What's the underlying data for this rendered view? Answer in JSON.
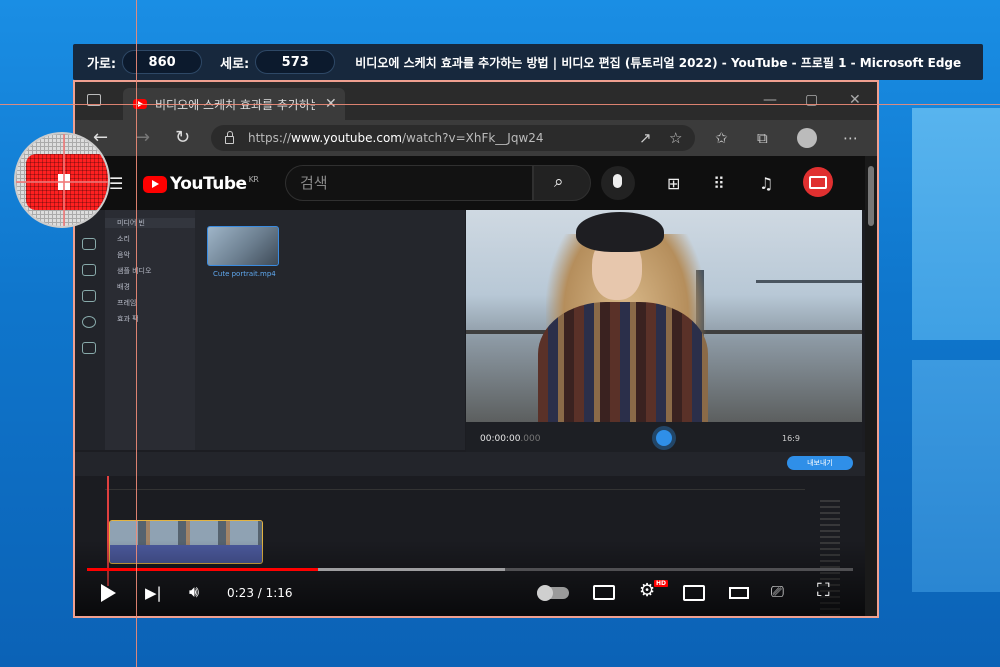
{
  "capture": {
    "width_label": "가로:",
    "width_value": "860",
    "height_label": "세로:",
    "height_value": "573",
    "window_title": "비디오에 스케치 효과를 추가하는 방법 | 비디오 편집 (튜토리얼 2022) - YouTube - 프로필 1 - Microsoft Edge"
  },
  "browser": {
    "tab_title": "비디오에 스케치 효과를 추가하는 방법",
    "tab_close": "✕",
    "url_prefix": "https://",
    "url_host": "www.youtube.com",
    "url_path": "/watch?v=XhFk__Jqw24"
  },
  "youtube": {
    "logo_text": "YouTube",
    "region": "KR",
    "search_placeholder": "검색",
    "time_display": "0:23 / 1:16",
    "played_fraction": 0.302,
    "loaded_fraction": 0.546,
    "hd_badge": "HD"
  },
  "editor": {
    "side_items": [
      "미디어 빈",
      "소리",
      "음악",
      "샘플 비디오",
      "배경",
      "프레임",
      "효과 팩"
    ],
    "media_file": "Cute portrait.mp4",
    "preview_time": "00:00:00",
    "preview_ms": ".000",
    "aspect_ratio": "16:9",
    "export_label": "내보내기"
  },
  "colors": {
    "yt_red": "#ff0000",
    "editor_accent": "#2f8fe8",
    "selection": "#f0a090"
  }
}
